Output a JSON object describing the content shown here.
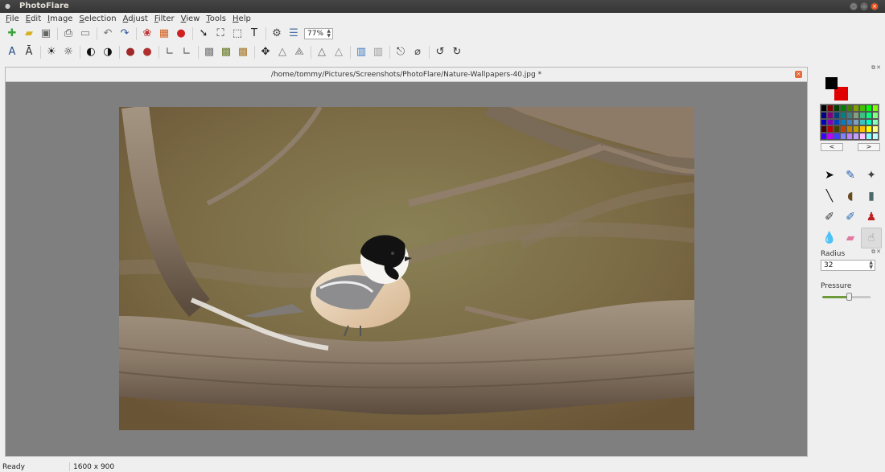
{
  "window": {
    "title": "PhotoFlare"
  },
  "menu": [
    "File",
    "Edit",
    "Image",
    "Selection",
    "Adjust",
    "Filter",
    "View",
    "Tools",
    "Help"
  ],
  "toolbar_top": [
    {
      "name": "new-file-icon",
      "glyph": "✚",
      "color": "#3aa33a"
    },
    {
      "name": "open-folder-icon",
      "glyph": "▰",
      "color": "#d8b020"
    },
    {
      "name": "save-icon",
      "glyph": "▣",
      "color": "#666"
    },
    {
      "sep": true
    },
    {
      "name": "print-icon",
      "glyph": "⎙",
      "color": "#444"
    },
    {
      "name": "scanner-icon",
      "glyph": "▭",
      "color": "#777"
    },
    {
      "sep": true
    },
    {
      "name": "undo-icon",
      "glyph": "↶",
      "color": "#777"
    },
    {
      "name": "redo-icon",
      "glyph": "↷",
      "color": "#2c5aa0"
    },
    {
      "sep": true
    },
    {
      "name": "color-circles-icon",
      "glyph": "❀",
      "color": "#c03030"
    },
    {
      "name": "color-grid-icon",
      "glyph": "▦",
      "color": "#d06020"
    },
    {
      "name": "color-balance-icon",
      "glyph": "●",
      "color": "#d02020"
    },
    {
      "sep": true
    },
    {
      "name": "pointer-tool-icon",
      "glyph": "➘",
      "color": "#222"
    },
    {
      "name": "crop-icon",
      "glyph": "⛶",
      "color": "#333"
    },
    {
      "name": "select-icon",
      "glyph": "⬚",
      "color": "#333"
    },
    {
      "name": "text-tool-icon",
      "glyph": "T",
      "color": "#222"
    },
    {
      "sep": true
    },
    {
      "name": "settings-gear-icon",
      "glyph": "⚙",
      "color": "#444"
    },
    {
      "name": "layers-list-icon",
      "glyph": "☰",
      "color": "#4a6fa5"
    }
  ],
  "zoom": "77%",
  "toolbar_second": [
    {
      "name": "font-style-icon",
      "glyph": "A",
      "color": "#2a4f8a"
    },
    {
      "name": "font-effect-icon",
      "glyph": "Ā",
      "color": "#333"
    },
    {
      "sep": true
    },
    {
      "name": "brightness-up-icon",
      "glyph": "☀",
      "color": "#222"
    },
    {
      "name": "brightness-down-icon",
      "glyph": "☼",
      "color": "#222"
    },
    {
      "sep": true
    },
    {
      "name": "contrast-up-icon",
      "glyph": "◐",
      "color": "#111"
    },
    {
      "name": "contrast-down-icon",
      "glyph": "◑",
      "color": "#111"
    },
    {
      "sep": true
    },
    {
      "name": "saturation-up-icon",
      "glyph": "●",
      "color": "#a02828"
    },
    {
      "name": "saturation-down-icon",
      "glyph": "●",
      "color": "#b03030"
    },
    {
      "sep": true
    },
    {
      "name": "gamma-up-icon",
      "glyph": "∟",
      "color": "#555"
    },
    {
      "name": "gamma-down-icon",
      "glyph": "∟",
      "color": "#555"
    },
    {
      "sep": true
    },
    {
      "name": "grayscale-icon",
      "glyph": "▩",
      "color": "#777"
    },
    {
      "name": "greenscale-icon",
      "glyph": "▩",
      "color": "#6a7a2a"
    },
    {
      "name": "sepia-icon",
      "glyph": "▩",
      "color": "#a57a30"
    },
    {
      "sep": true
    },
    {
      "name": "move-icon",
      "glyph": "✥",
      "color": "#222"
    },
    {
      "name": "sharpen-icon",
      "glyph": "△",
      "color": "#777"
    },
    {
      "name": "soften-icon",
      "glyph": "⟁",
      "color": "#777"
    },
    {
      "sep": true
    },
    {
      "name": "triangle-outline-icon",
      "glyph": "△",
      "color": "#666"
    },
    {
      "name": "triangle-shaded-icon",
      "glyph": "△",
      "color": "#888"
    },
    {
      "sep": true
    },
    {
      "name": "gradient-color-icon",
      "glyph": "▥",
      "color": "#3a7ac0"
    },
    {
      "name": "gradient-gray-icon",
      "glyph": "▥",
      "color": "#999"
    },
    {
      "sep": true
    },
    {
      "name": "stamp-clone-icon",
      "glyph": "⎋",
      "color": "#444"
    },
    {
      "name": "magic-eraser-icon",
      "glyph": "⌀",
      "color": "#444"
    },
    {
      "sep": true
    },
    {
      "name": "rotate-left-icon",
      "glyph": "↺",
      "color": "#333"
    },
    {
      "name": "rotate-right-icon",
      "glyph": "↻",
      "color": "#333"
    }
  ],
  "document": {
    "path": "/home/tommy/Pictures/Screenshots/PhotoFlare/Nature-Wallpapers-40.jpg *"
  },
  "status": {
    "message": "Ready",
    "dimensions": "1600 x 900"
  },
  "right_panel": {
    "foreground_color": "#000000",
    "background_color": "#e00000",
    "palette": [
      "#000000",
      "#800000",
      "#004000",
      "#008000",
      "#408000",
      "#80a000",
      "#40c000",
      "#00ff00",
      "#80ff00",
      "#000080",
      "#800080",
      "#004080",
      "#008080",
      "#408080",
      "#80a080",
      "#40c080",
      "#00ff80",
      "#80ff80",
      "#0000c0",
      "#8000c0",
      "#0040c0",
      "#0080c0",
      "#4080c0",
      "#80a0c0",
      "#40c0c0",
      "#00ffc0",
      "#80ffc0",
      "#400000",
      "#c00000",
      "#404000",
      "#c04000",
      "#c08000",
      "#c0a000",
      "#ffc000",
      "#ffff00",
      "#ffff80",
      "#4000ff",
      "#c000ff",
      "#4040ff",
      "#8080ff",
      "#c080ff",
      "#c0a0ff",
      "#ffc0ff",
      "#80ffff",
      "#c0ffff"
    ],
    "palette_prev": "<",
    "palette_next": ">",
    "tools": [
      {
        "name": "arrow-pointer-icon",
        "glyph": "➤",
        "color": "#111"
      },
      {
        "name": "eyedropper-icon",
        "glyph": "✎",
        "color": "#2a60b0"
      },
      {
        "name": "magic-wand-icon",
        "glyph": "✦",
        "color": "#444"
      },
      {
        "name": "line-tool-icon",
        "glyph": "╲",
        "color": "#111"
      },
      {
        "name": "paint-bucket-icon",
        "glyph": "◖",
        "color": "#6a4a20"
      },
      {
        "name": "spray-can-icon",
        "glyph": "▮",
        "color": "#4a6a6a"
      },
      {
        "name": "paintbrush-icon",
        "glyph": "✐",
        "color": "#3a3a3a"
      },
      {
        "name": "clone-brush-icon",
        "glyph": "✐",
        "color": "#2a6ab0"
      },
      {
        "name": "stamp-icon",
        "glyph": "♟",
        "color": "#c02020"
      },
      {
        "name": "blur-drop-icon",
        "glyph": "💧",
        "color": "#5a9ad0"
      },
      {
        "name": "eraser-icon",
        "glyph": "▰",
        "color": "#e07aa0"
      },
      {
        "name": "smudge-icon",
        "glyph": "☝",
        "color": "#888"
      }
    ],
    "radius_label": "Radius",
    "radius_value": "32",
    "pressure_label": "Pressure",
    "pressure_level": 0.55
  }
}
